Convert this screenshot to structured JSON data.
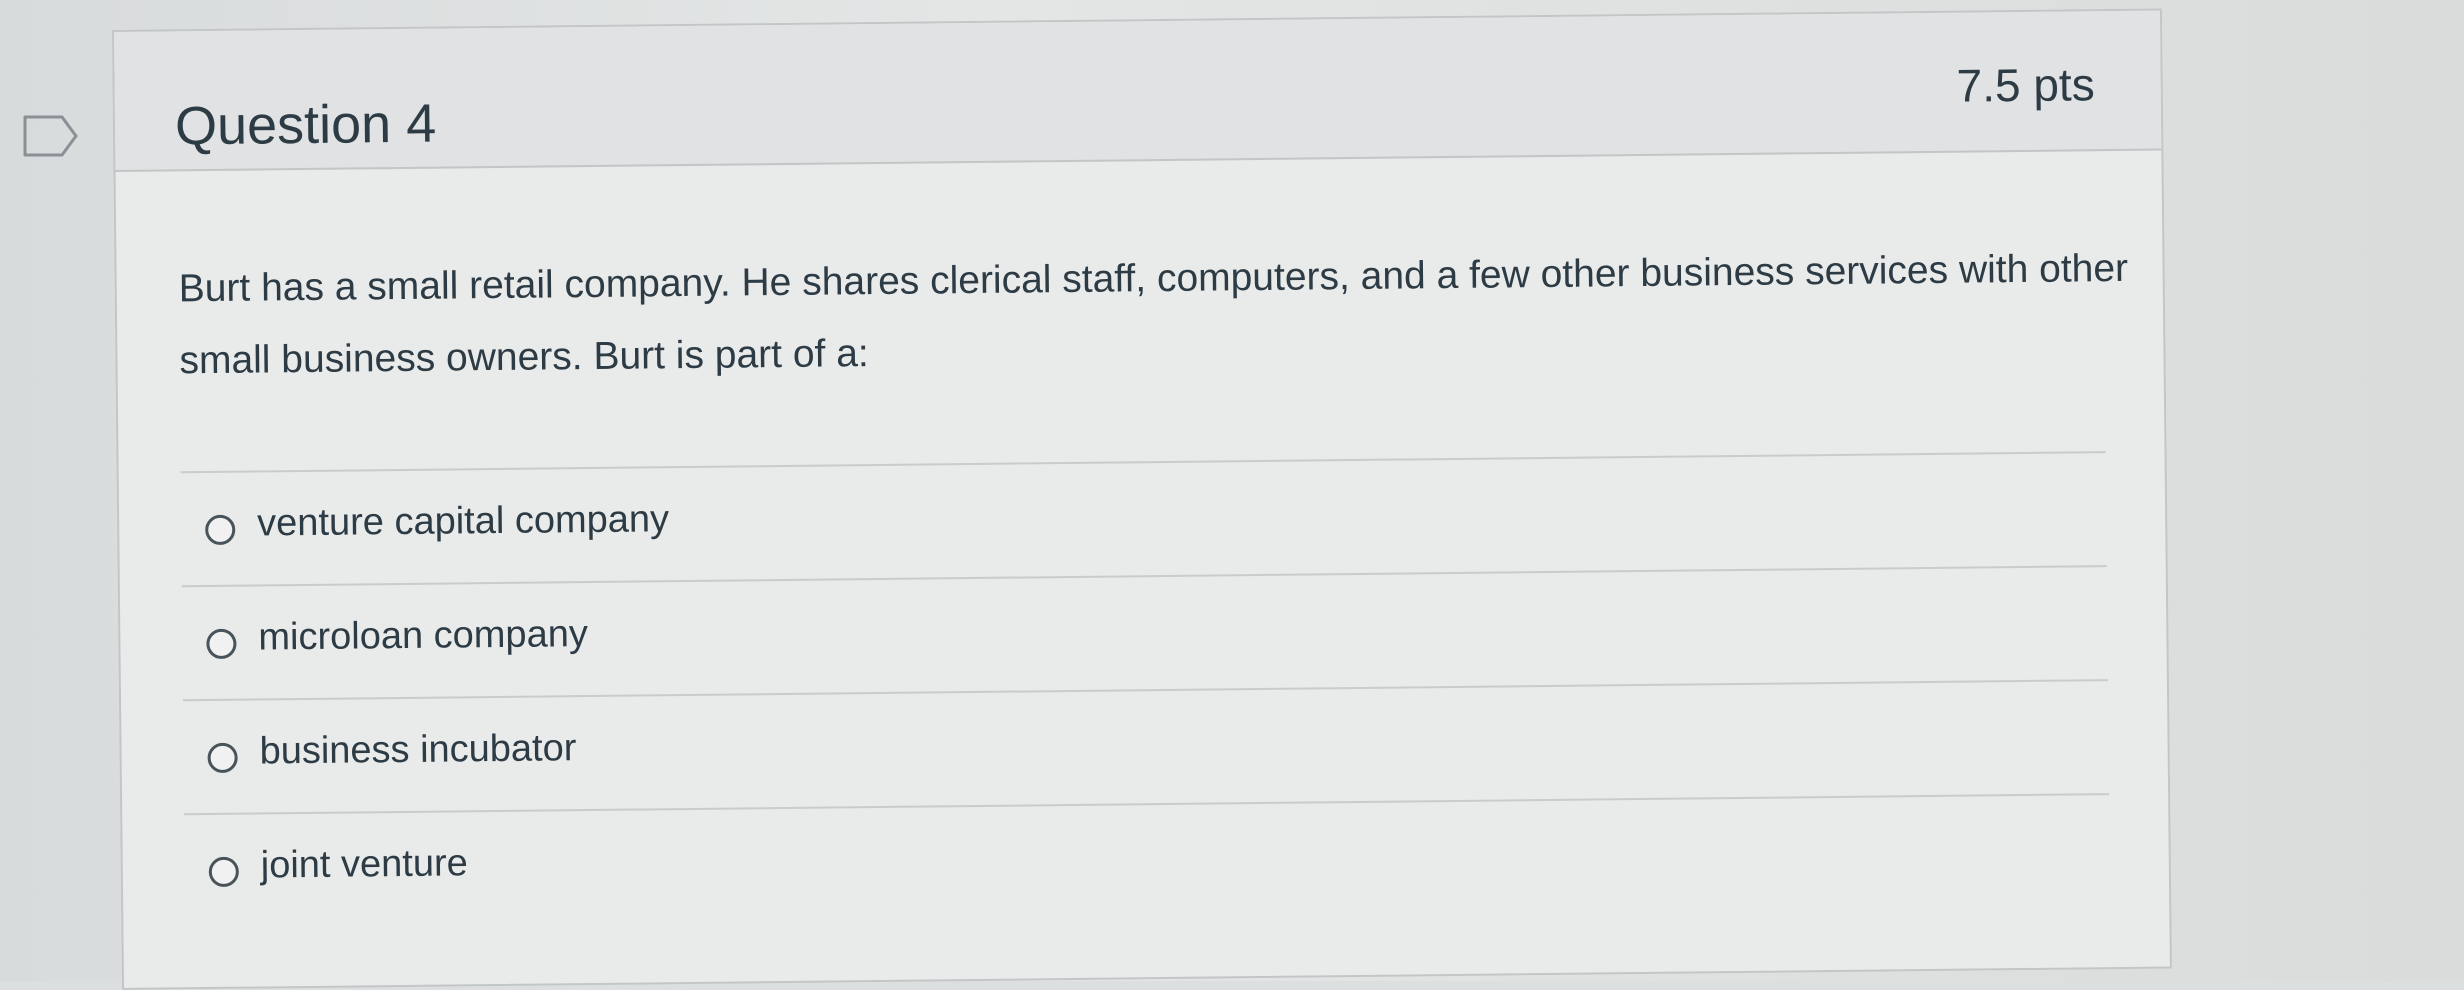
{
  "question": {
    "title": "Question 4",
    "points": "7.5 pts",
    "text": "Burt has a small retail company. He shares clerical staff, computers, and a few other business services with other small business owners. Burt is part of a:",
    "answers": [
      {
        "label": "venture capital company",
        "selected": false
      },
      {
        "label": "microloan company",
        "selected": false
      },
      {
        "label": "business incubator",
        "selected": false
      },
      {
        "label": "joint venture",
        "selected": false
      }
    ]
  },
  "icons": {
    "flag": "flag-question-icon",
    "radio": "radio-button-icon"
  },
  "colors": {
    "text": "#2d3b45",
    "border": "#c2c6c7",
    "header_bg": "#e0e2e3"
  }
}
